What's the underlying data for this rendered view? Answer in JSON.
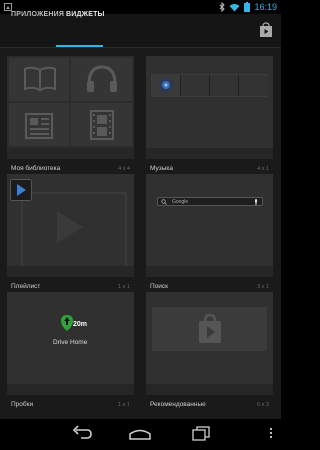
{
  "status_bar": {
    "time": "16:19",
    "icons": [
      "image-icon",
      "bluetooth-icon",
      "wifi-icon",
      "battery-icon"
    ]
  },
  "tabs": [
    {
      "label": "ПРИЛОЖЕНИЯ",
      "selected": false
    },
    {
      "label": "ВИДЖЕТЫ",
      "selected": true
    }
  ],
  "toolbar": {
    "store_icon": "play-store-icon"
  },
  "widgets": [
    {
      "label": "Моя библиотека",
      "size": "4 x 4"
    },
    {
      "label": "Музыка",
      "size": "4 x 1"
    },
    {
      "label": "Плейлист",
      "size": "1 x 1"
    },
    {
      "label": "Поиск",
      "size": "3 x 1"
    },
    {
      "label": "Пробки",
      "size": "1 x 1"
    },
    {
      "label": "Рекомендованные",
      "size": "6 x 3"
    }
  ],
  "previews": {
    "search_hint": "Google",
    "traffic_time": "20m",
    "traffic_destination": "Drive Home"
  },
  "nav_bar": {
    "icons": [
      "back-icon",
      "home-icon",
      "recents-icon",
      "menu-icon"
    ]
  },
  "colors": {
    "accent": "#33b5e5",
    "background": "#1a1a1a",
    "card": "#262626"
  }
}
